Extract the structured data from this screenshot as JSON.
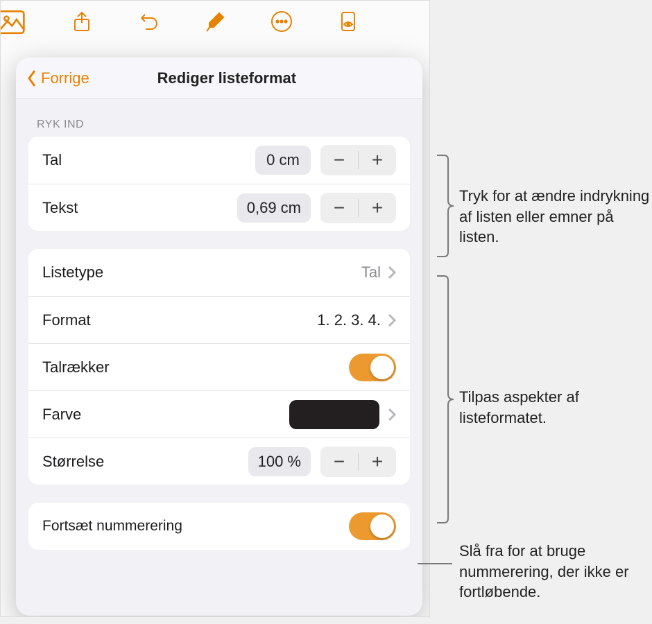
{
  "header": {
    "back_label": "Forrige",
    "title": "Rediger listeformat"
  },
  "sections": {
    "indent_header": "RYK IND",
    "tal": {
      "label": "Tal",
      "value": "0 cm"
    },
    "tekst": {
      "label": "Tekst",
      "value": "0,69 cm"
    },
    "listetype": {
      "label": "Listetype",
      "value": "Tal"
    },
    "format": {
      "label": "Format",
      "value": "1. 2. 3. 4."
    },
    "talraekker": {
      "label": "Talrækker"
    },
    "farve": {
      "label": "Farve"
    },
    "stoerrelse": {
      "label": "Størrelse",
      "value": "100 %"
    },
    "fortsaet": {
      "label": "Fortsæt nummerering"
    }
  },
  "stepper": {
    "minus": "−",
    "plus": "+"
  },
  "colors": {
    "accent": "#e78200",
    "swatch": "#231f20"
  },
  "callouts": {
    "c1": "Tryk for at ændre indrykning af listen eller emner på listen.",
    "c2": "Tilpas aspekter af listeformatet.",
    "c3": "Slå fra for at bruge nummerering, der ikke er fortløbende."
  }
}
